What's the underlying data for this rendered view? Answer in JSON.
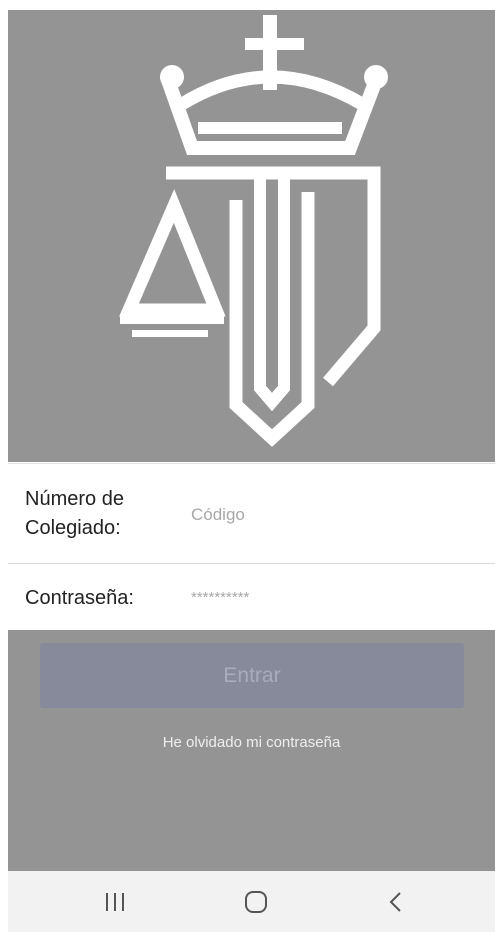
{
  "login_form": {
    "user_label": "Número de\nColegiado:",
    "user_placeholder": "Código",
    "password_label": "Contraseña:",
    "password_placeholder": "**********"
  },
  "actions": {
    "login_label": "Entrar",
    "forgot_password_label": "He olvidado mi contraseña"
  },
  "navbar": {
    "recents_icon": "recents-icon",
    "home_icon": "home-icon",
    "back_icon": "back-chevron-icon"
  },
  "colors": {
    "background_gray": "#949494",
    "logo_white": "#ffffff",
    "button_bg": "#868a9b",
    "button_text": "#a9acba",
    "navbar_bg": "#f2f2f2"
  }
}
